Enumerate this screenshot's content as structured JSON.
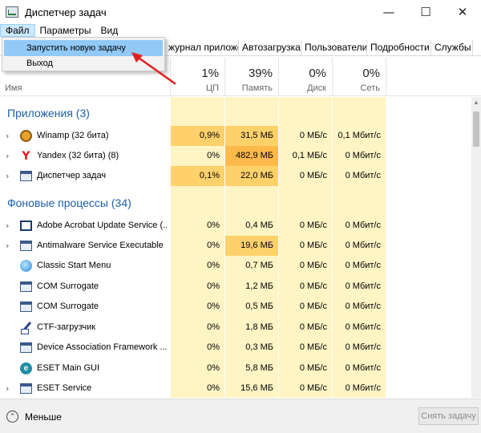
{
  "window": {
    "title": "Диспетчер задач",
    "minimize_icon": "minimize-icon",
    "maximize_icon": "maximize-icon",
    "close_icon": "close-icon"
  },
  "menubar": {
    "file": "Файл",
    "options": "Параметры",
    "view": "Вид"
  },
  "file_menu": {
    "run_new_task": "Запустить новую задачу",
    "exit": "Выход"
  },
  "tabs": [
    "журнал приложений",
    "Автозагрузка",
    "Пользователи",
    "Подробности",
    "Службы"
  ],
  "columns": {
    "name": "Имя",
    "cpu_pct": "1%",
    "cpu": "ЦП",
    "mem_pct": "39%",
    "mem": "Память",
    "disk_pct": "0%",
    "disk": "Диск",
    "net_pct": "0%",
    "net": "Сеть"
  },
  "groups": {
    "apps": "Приложения (3)",
    "background": "Фоновые процессы (34)"
  },
  "apps": [
    {
      "name": "Winamp (32 бита)",
      "cpu": "0,9%",
      "mem": "31,5 МБ",
      "disk": "0 МБ/с",
      "net": "0,1 Мбит/с",
      "icon": "winamp-icon",
      "expandable": true
    },
    {
      "name": "Yandex (32 бита) (8)",
      "cpu": "0%",
      "mem": "482,9 МБ",
      "disk": "0,1 МБ/с",
      "net": "0 Мбит/с",
      "icon": "yandex-icon",
      "expandable": true
    },
    {
      "name": "Диспетчер задач",
      "cpu": "0,1%",
      "mem": "22,0 МБ",
      "disk": "0 МБ/с",
      "net": "0 Мбит/с",
      "icon": "task-manager-icon",
      "expandable": true
    }
  ],
  "background": [
    {
      "name": "Adobe Acrobat Update Service (...",
      "cpu": "0%",
      "mem": "0,4 МБ",
      "disk": "0 МБ/с",
      "net": "0 Мбит/с",
      "icon": "acrobat-icon",
      "expandable": true
    },
    {
      "name": "Antimalware Service Executable",
      "cpu": "0%",
      "mem": "19,6 МБ",
      "disk": "0 МБ/с",
      "net": "0 Мбит/с",
      "icon": "app-window-icon",
      "expandable": true
    },
    {
      "name": "Classic Start Menu",
      "cpu": "0%",
      "mem": "0,7 МБ",
      "disk": "0 МБ/с",
      "net": "0 Мбит/с",
      "icon": "classic-start-menu-icon",
      "expandable": false
    },
    {
      "name": "COM Surrogate",
      "cpu": "0%",
      "mem": "1,2 МБ",
      "disk": "0 МБ/с",
      "net": "0 Мбит/с",
      "icon": "app-window-icon",
      "expandable": false
    },
    {
      "name": "COM Surrogate",
      "cpu": "0%",
      "mem": "0,5 МБ",
      "disk": "0 МБ/с",
      "net": "0 Мбит/с",
      "icon": "app-window-icon",
      "expandable": false
    },
    {
      "name": "CTF-загрузчик",
      "cpu": "0%",
      "mem": "1,8 МБ",
      "disk": "0 МБ/с",
      "net": "0 Мбит/с",
      "icon": "ctf-loader-icon",
      "expandable": false
    },
    {
      "name": "Device Association Framework ...",
      "cpu": "0%",
      "mem": "0,3 МБ",
      "disk": "0 МБ/с",
      "net": "0 Мбит/с",
      "icon": "app-window-icon",
      "expandable": false
    },
    {
      "name": "ESET Main GUI",
      "cpu": "0%",
      "mem": "5,8 МБ",
      "disk": "0 МБ/с",
      "net": "0 Мбит/с",
      "icon": "eset-icon",
      "expandable": false
    },
    {
      "name": "ESET Service",
      "cpu": "0%",
      "mem": "15,6 МБ",
      "disk": "0 МБ/с",
      "net": "0 Мбит/с",
      "icon": "app-window-icon",
      "expandable": true
    }
  ],
  "footer": {
    "less": "Меньше",
    "end_task": "Снять задачу"
  },
  "colors": {
    "heat_low": "#fff4c4",
    "heat_high": "#ffd16b",
    "group_text": "#1e5fa8",
    "menu_highlight": "#91c9f7",
    "annotation_arrow": "#e02020"
  }
}
